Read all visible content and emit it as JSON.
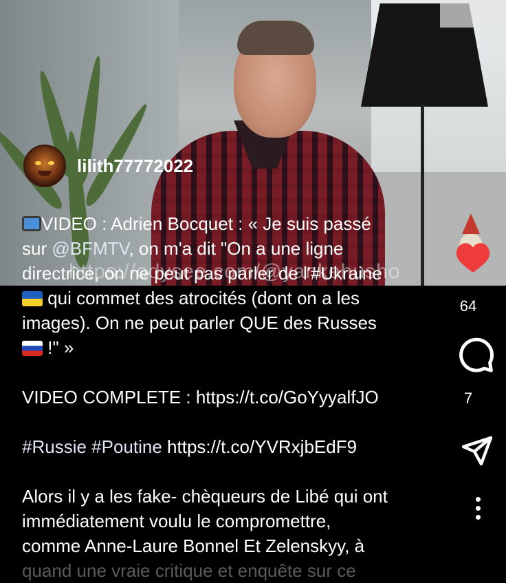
{
  "author": {
    "username": "lilith77772022",
    "avatar_icon": "avatar-devil-icon"
  },
  "video": {
    "watermark": "https://odysee.com/@yankehusho"
  },
  "caption": {
    "line1_prefix_icon": "tv-icon",
    "line1": "VIDEO : Adrien Bocquet : « Je suis passé",
    "line2_pre": "sur ",
    "line2_mention": "@BFMTV",
    "line2_post": ", on m'a dit \"On a une ligne",
    "line3": "directrice, on ne peut pas parler de l'#Ukraine",
    "line4": " qui commet des atrocités (dont on a les",
    "line5": "images). On ne peut parler QUE des Russes",
    "line6": " !\" »",
    "video_complete": "VIDEO COMPLETE : https://t.co/GoYyyalfJO",
    "hashtag1": "#Russie",
    "hashtag2": "#Poutine",
    "link2": " https://t.co/YVRxjbEdF9",
    "para2_line1": "Alors il y a les fake- chèqueurs de Libé qui ont",
    "para2_line2": "immédiatement voulu le compromettre,",
    "para2_line3": "comme Anne-Laure Bonnel Et Zelenskyy, à",
    "para2_line4": "quand une vraie critique et enquête sur ce"
  },
  "actions": {
    "likes": "64",
    "comments": "7",
    "like_color": "#ee3b3b"
  }
}
